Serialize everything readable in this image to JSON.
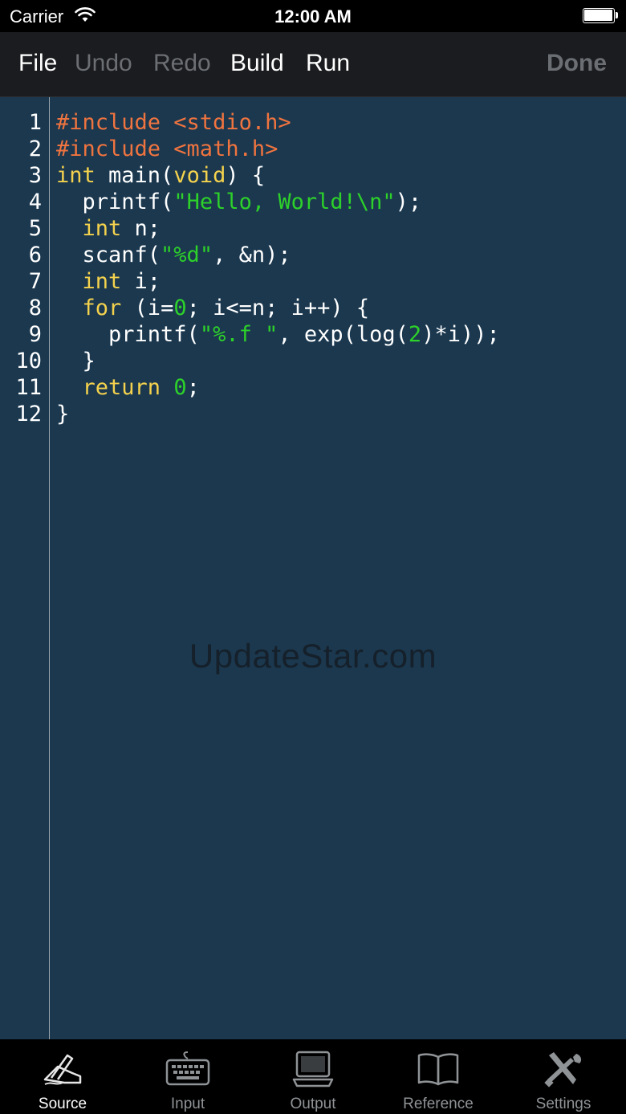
{
  "status_bar": {
    "carrier": "Carrier",
    "time": "12:00 AM"
  },
  "toolbar": {
    "file": "File",
    "undo": "Undo",
    "redo": "Redo",
    "build": "Build",
    "run": "Run",
    "done": "Done"
  },
  "editor": {
    "line_numbers": [
      "1",
      "2",
      "3",
      "4",
      "5",
      "6",
      "7",
      "8",
      "9",
      "10",
      "11",
      "12"
    ],
    "lines": [
      [
        {
          "t": "#include <stdio.h>",
          "k": "pre"
        }
      ],
      [
        {
          "t": "#include <math.h>",
          "k": "pre"
        }
      ],
      [
        {
          "t": "int",
          "k": "kw"
        },
        {
          "t": " main(",
          "k": "pl"
        },
        {
          "t": "void",
          "k": "kw"
        },
        {
          "t": ") {",
          "k": "pl"
        }
      ],
      [
        {
          "t": "  printf(",
          "k": "pl"
        },
        {
          "t": "\"Hello, World!\\n\"",
          "k": "str"
        },
        {
          "t": ");",
          "k": "pl"
        }
      ],
      [
        {
          "t": "  ",
          "k": "pl"
        },
        {
          "t": "int",
          "k": "kw"
        },
        {
          "t": " n;",
          "k": "pl"
        }
      ],
      [
        {
          "t": "  scanf(",
          "k": "pl"
        },
        {
          "t": "\"%d\"",
          "k": "str"
        },
        {
          "t": ", &n);",
          "k": "pl"
        }
      ],
      [
        {
          "t": "  ",
          "k": "pl"
        },
        {
          "t": "int",
          "k": "kw"
        },
        {
          "t": " i;",
          "k": "pl"
        }
      ],
      [
        {
          "t": "  ",
          "k": "pl"
        },
        {
          "t": "for",
          "k": "kw"
        },
        {
          "t": " (i=",
          "k": "pl"
        },
        {
          "t": "0",
          "k": "num"
        },
        {
          "t": "; i<=n; i++) {",
          "k": "pl"
        }
      ],
      [
        {
          "t": "    printf(",
          "k": "pl"
        },
        {
          "t": "\"%.f \"",
          "k": "str"
        },
        {
          "t": ", exp(log(",
          "k": "pl"
        },
        {
          "t": "2",
          "k": "num"
        },
        {
          "t": ")*i));",
          "k": "pl"
        }
      ],
      [
        {
          "t": "  }",
          "k": "pl"
        }
      ],
      [
        {
          "t": "  ",
          "k": "pl"
        },
        {
          "t": "return",
          "k": "kw"
        },
        {
          "t": " ",
          "k": "pl"
        },
        {
          "t": "0",
          "k": "num"
        },
        {
          "t": ";",
          "k": "pl"
        }
      ],
      [
        {
          "t": "}",
          "k": "pl"
        }
      ]
    ]
  },
  "watermark": "UpdateStar.com",
  "tabs": [
    {
      "label": "Source",
      "icon": "source-pen-icon",
      "active": true
    },
    {
      "label": "Input",
      "icon": "keyboard-icon",
      "active": false
    },
    {
      "label": "Output",
      "icon": "computer-icon",
      "active": false
    },
    {
      "label": "Reference",
      "icon": "book-icon",
      "active": false
    },
    {
      "label": "Settings",
      "icon": "tools-icon",
      "active": false
    }
  ],
  "colors": {
    "editor_bg": "#1b384f",
    "preprocessor": "#f0743f",
    "keyword": "#f4d24d",
    "string": "#2dd12a",
    "plain": "#ffffff"
  }
}
